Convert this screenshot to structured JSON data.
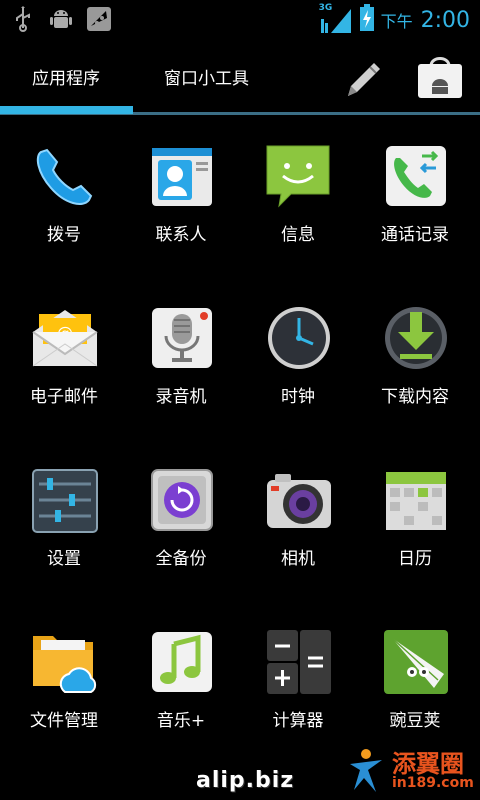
{
  "status_bar": {
    "network": "3G",
    "ampm": "下午",
    "time": "2:00",
    "accent": "#33b5e5"
  },
  "tabs": [
    {
      "label": "应用程序",
      "selected": true
    },
    {
      "label": "窗口小工具",
      "selected": false
    }
  ],
  "apps": [
    {
      "label": "拨号",
      "icon": "phone-icon"
    },
    {
      "label": "联系人",
      "icon": "contacts-icon"
    },
    {
      "label": "信息",
      "icon": "messaging-icon"
    },
    {
      "label": "通话记录",
      "icon": "call-log-icon"
    },
    {
      "label": "电子邮件",
      "icon": "email-icon"
    },
    {
      "label": "录音机",
      "icon": "sound-recorder-icon"
    },
    {
      "label": "时钟",
      "icon": "clock-icon"
    },
    {
      "label": "下载内容",
      "icon": "downloads-icon"
    },
    {
      "label": "设置",
      "icon": "settings-icon"
    },
    {
      "label": "全备份",
      "icon": "backup-icon"
    },
    {
      "label": "相机",
      "icon": "camera-icon"
    },
    {
      "label": "日历",
      "icon": "calendar-icon"
    },
    {
      "label": "文件管理",
      "icon": "file-manager-icon"
    },
    {
      "label": "音乐+",
      "icon": "music-icon"
    },
    {
      "label": "计算器",
      "icon": "calculator-icon"
    },
    {
      "label": "豌豆荚",
      "icon": "wandoujia-icon"
    }
  ],
  "watermarks": {
    "site": "alip.biz",
    "brand": "添翼圈",
    "brand_url": "in189.com"
  }
}
